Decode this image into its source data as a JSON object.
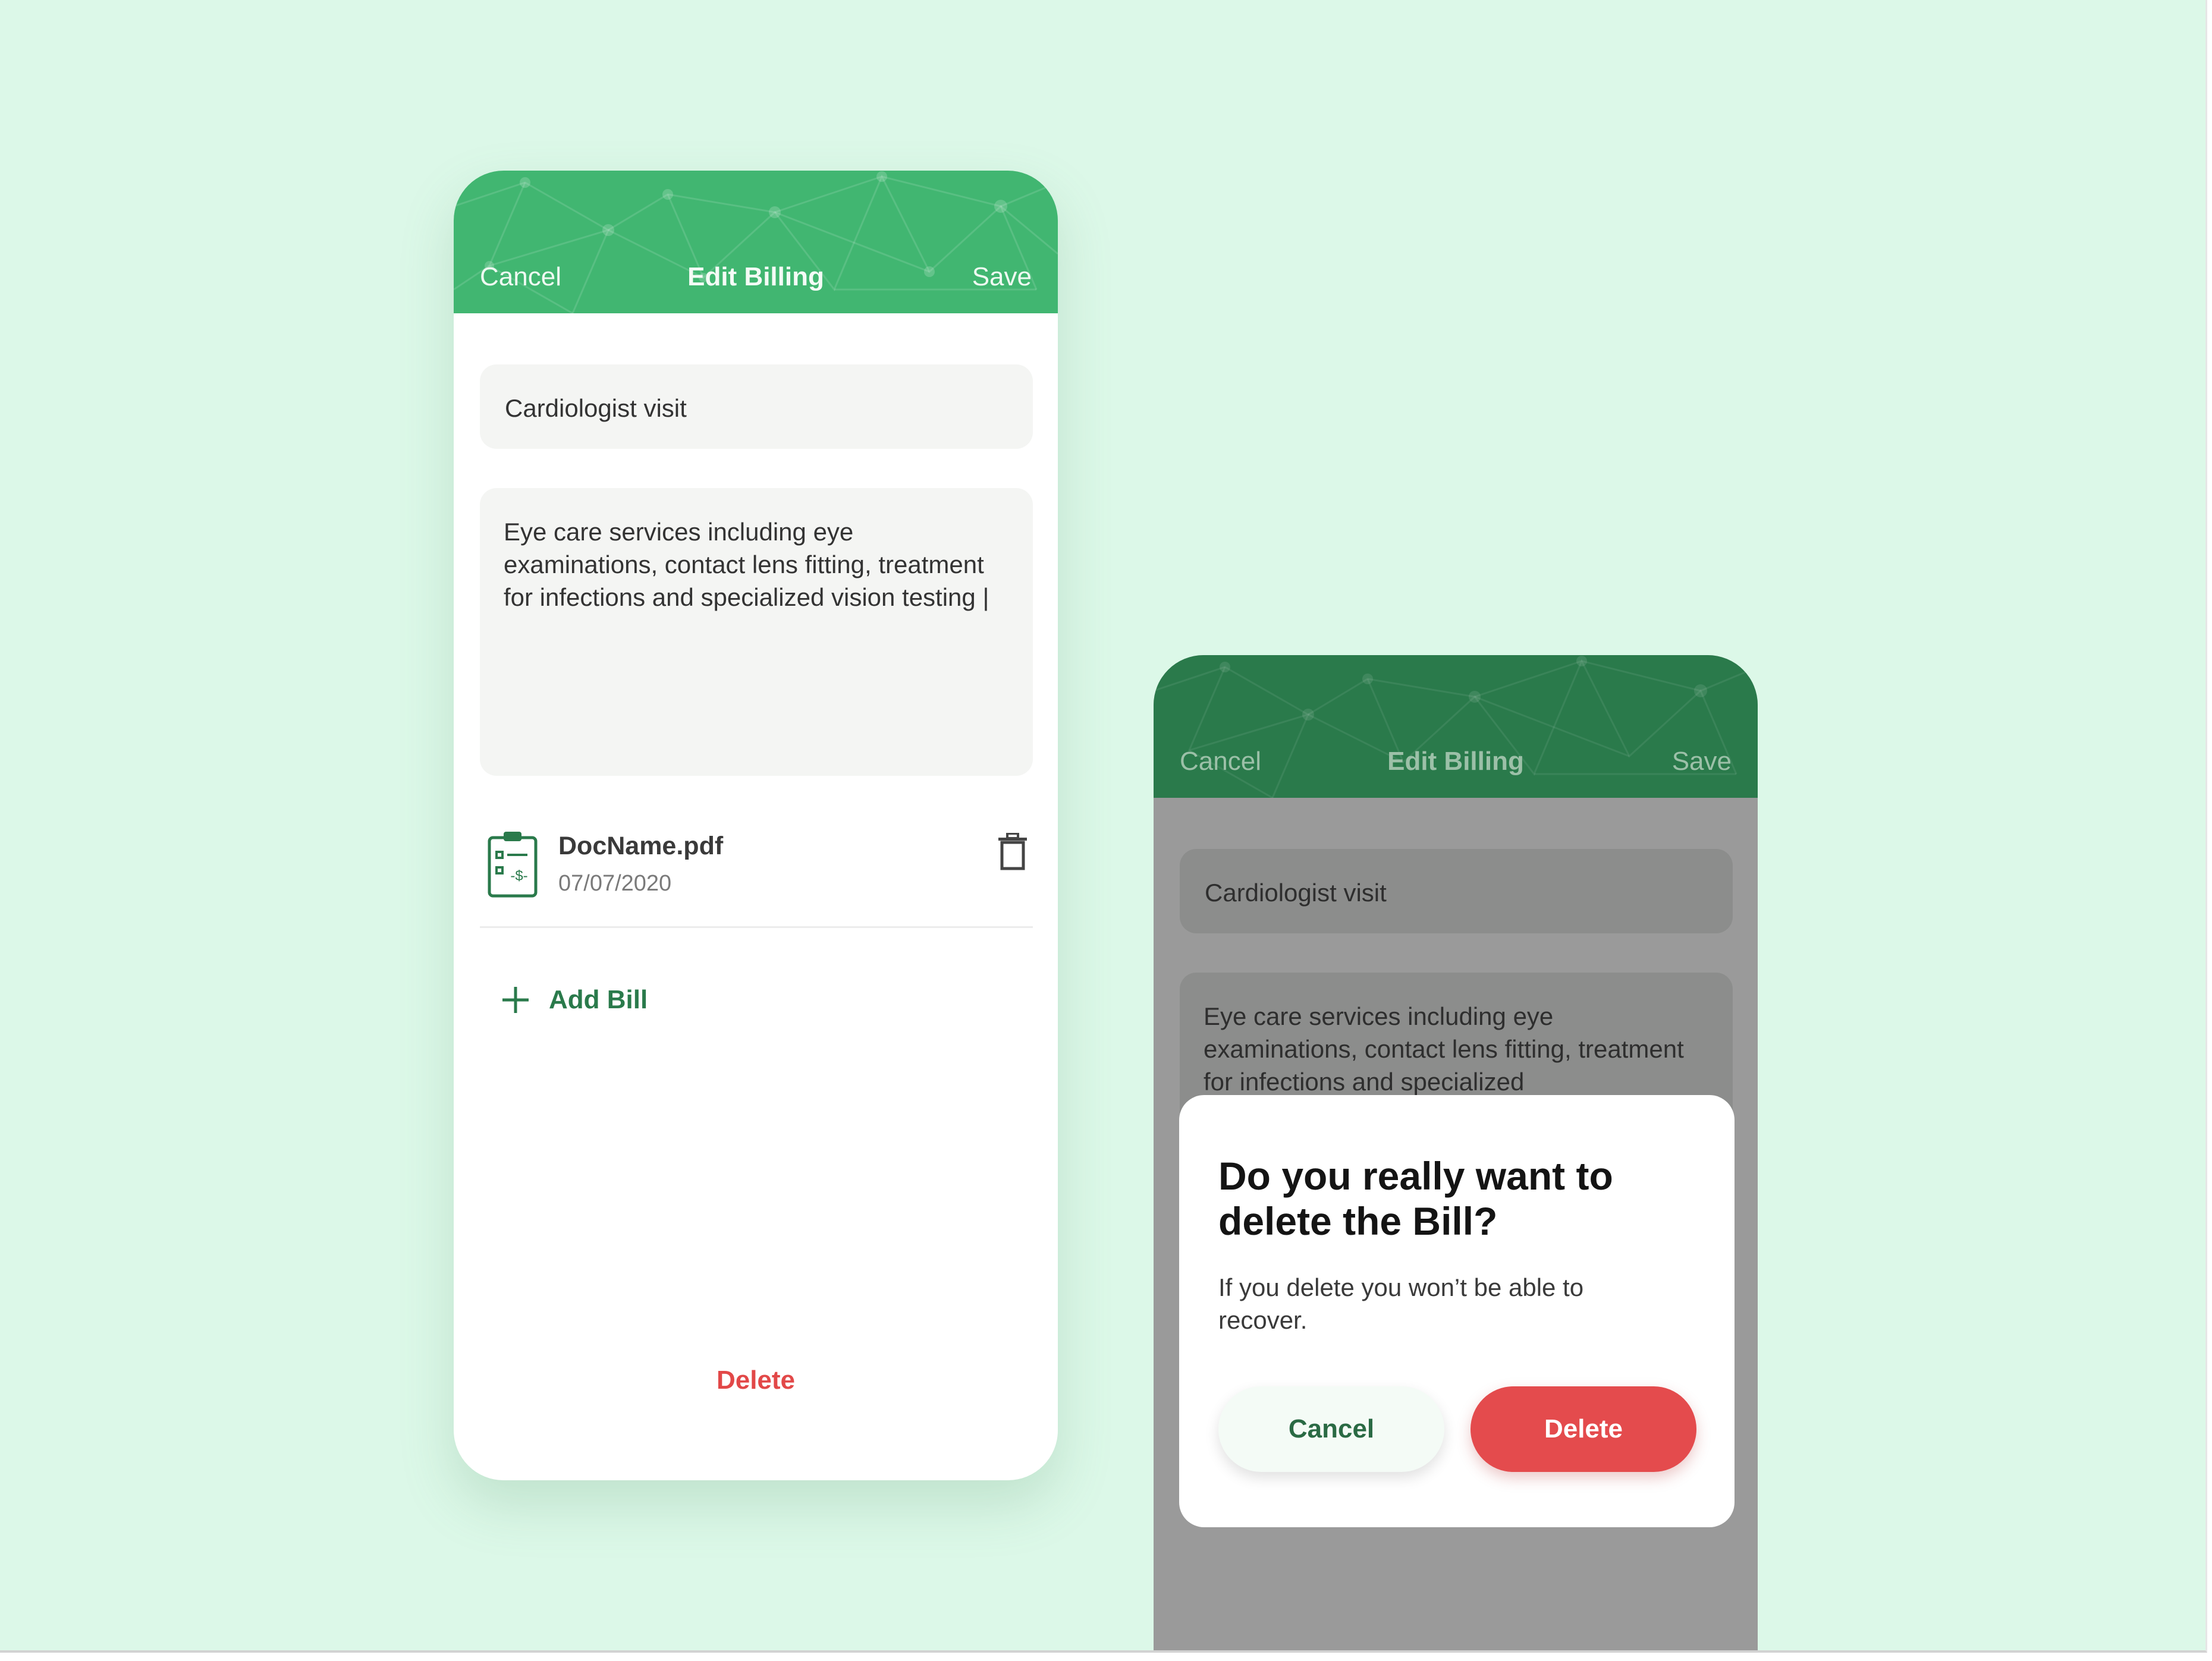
{
  "colors": {
    "background": "#dcf8e8",
    "header_green": "#41b671",
    "header_green_dimmed": "#2a7a4b",
    "accent_green": "#2a7a4b",
    "danger_red": "#e24848",
    "overlay_gray": "#9a9a9a"
  },
  "screen_edit": {
    "header": {
      "cancel": "Cancel",
      "title": "Edit Billing",
      "save": "Save"
    },
    "title_field": {
      "value": "Cardiologist visit"
    },
    "description_field": {
      "value": "Eye care services including eye examinations, contact lens fitting, treatment for infections and specialized vision testing |"
    },
    "attachment": {
      "icon": "clipboard-bill-icon",
      "name": "DocName.pdf",
      "date": "07/07/2020",
      "action_icon": "trash-icon"
    },
    "add_bill": {
      "icon": "plus-icon",
      "label": "Add Bill"
    },
    "delete_label": "Delete"
  },
  "screen_confirm": {
    "header": {
      "cancel": "Cancel",
      "title": "Edit Billing",
      "save": "Save"
    },
    "title_field": {
      "value": "Cardiologist visit"
    },
    "description_field": {
      "value": "Eye care services including eye examinations, contact lens fitting, treatment for infections and specialized"
    },
    "dialog": {
      "question": "Do you really want to delete the Bill?",
      "message": "If you delete you won’t be able to recover.",
      "cancel_label": "Cancel",
      "delete_label": "Delete"
    }
  }
}
